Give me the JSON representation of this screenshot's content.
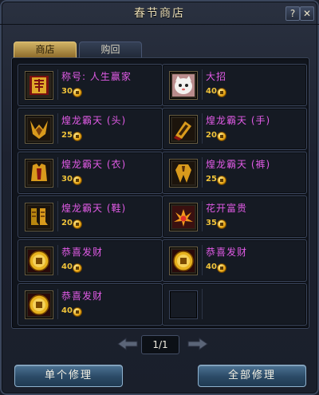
{
  "window": {
    "title": "春节商店",
    "help": "?",
    "close": "✕"
  },
  "tabs": [
    {
      "label": "商店",
      "active": true
    },
    {
      "label": "购回",
      "active": false
    }
  ],
  "items": [
    {
      "name": "称号: 人生赢家",
      "price": "30",
      "icon": "title-scroll-icon"
    },
    {
      "name": "大招",
      "price": "40",
      "icon": "white-cat-face-icon"
    },
    {
      "name": "煌龙霸天 (头)",
      "price": "25",
      "icon": "dragon-helmet-icon"
    },
    {
      "name": "煌龙霸天 (手)",
      "price": "20",
      "icon": "dragon-gauntlet-icon"
    },
    {
      "name": "煌龙霸天 (衣)",
      "price": "30",
      "icon": "dragon-armor-icon"
    },
    {
      "name": "煌龙霸天 (裤)",
      "price": "25",
      "icon": "dragon-leggings-icon"
    },
    {
      "name": "煌龙霸天 (鞋)",
      "price": "20",
      "icon": "dragon-boots-icon"
    },
    {
      "name": "花开富贵",
      "price": "35",
      "icon": "blooming-flower-icon"
    },
    {
      "name": "恭喜发财",
      "price": "40",
      "icon": "gold-coin-icon"
    },
    {
      "name": "恭喜发财",
      "price": "40",
      "icon": "gold-coin-icon"
    },
    {
      "name": "恭喜发财",
      "price": "40",
      "icon": "gold-coin-icon"
    }
  ],
  "pager": {
    "text": "1/1"
  },
  "buttons": {
    "repair_single": "单个修理",
    "repair_all": "全部修理"
  },
  "colors": {
    "item_name": "#e15be6",
    "price": "#f0c33a",
    "tab_active": "#c9a85a"
  }
}
